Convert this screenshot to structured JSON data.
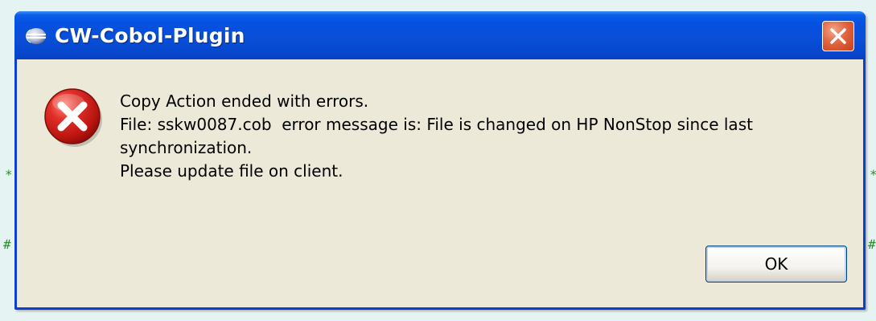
{
  "window": {
    "title": "CW-Cobol-Plugin",
    "icon": "eclipse-icon",
    "close_icon": "close-icon"
  },
  "dialog": {
    "icon": "error-icon",
    "message_lines": [
      "Copy Action ended with errors.",
      "File: sskw0087.cob  error message is: File is changed on HP NonStop since last",
      "synchronization.",
      "Please update file on client."
    ],
    "ok_label": "OK"
  },
  "background": {
    "marks": [
      "*",
      "#",
      "*",
      "#"
    ]
  },
  "colors": {
    "titlebar": "#0551e0",
    "dialog_bg": "#ece9d8",
    "close_button": "#e1653f",
    "error_icon": "#d0201c"
  }
}
